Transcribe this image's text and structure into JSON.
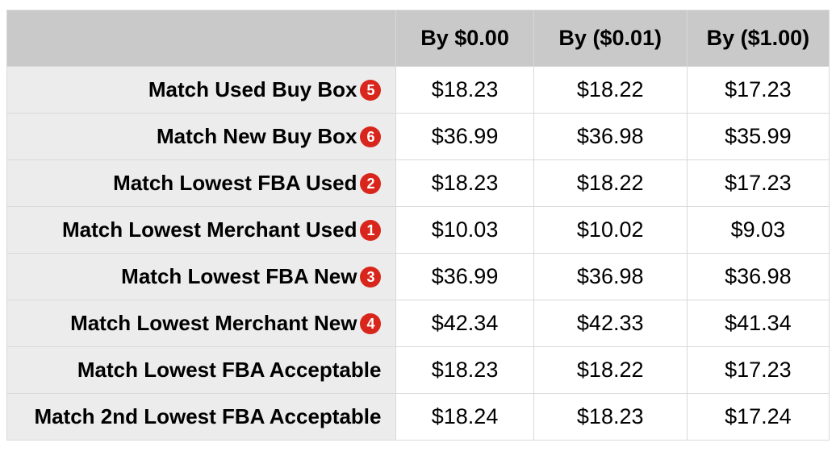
{
  "headers": {
    "blank": "",
    "col1": "By $0.00",
    "col2": "By ($0.01)",
    "col3": "By ($1.00)"
  },
  "rows": [
    {
      "label": "Match Used Buy Box",
      "badge": "5",
      "c1": "$18.23",
      "c2": "$18.22",
      "c3": "$17.23"
    },
    {
      "label": "Match New Buy Box",
      "badge": "6",
      "c1": "$36.99",
      "c2": "$36.98",
      "c3": "$35.99"
    },
    {
      "label": "Match Lowest FBA Used",
      "badge": "2",
      "c1": "$18.23",
      "c2": "$18.22",
      "c3": "$17.23"
    },
    {
      "label": "Match Lowest Merchant Used",
      "badge": "1",
      "c1": "$10.03",
      "c2": "$10.02",
      "c3": "$9.03"
    },
    {
      "label": "Match Lowest FBA New",
      "badge": "3",
      "c1": "$36.99",
      "c2": "$36.98",
      "c3": "$36.98"
    },
    {
      "label": "Match Lowest Merchant New",
      "badge": "4",
      "c1": "$42.34",
      "c2": "$42.33",
      "c3": "$41.34"
    },
    {
      "label": "Match Lowest FBA Acceptable",
      "badge": "",
      "c1": "$18.23",
      "c2": "$18.22",
      "c3": "$17.23"
    },
    {
      "label": "Match 2nd Lowest FBA Acceptable",
      "badge": "",
      "c1": "$18.24",
      "c2": "$18.23",
      "c3": "$17.24"
    }
  ]
}
